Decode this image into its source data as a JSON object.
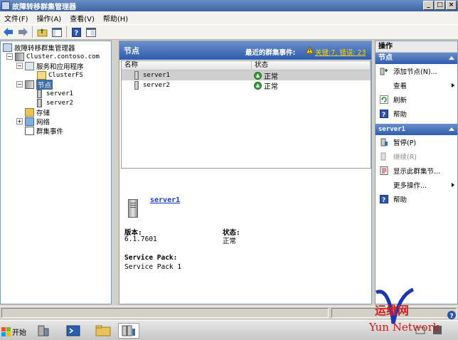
{
  "window": {
    "title": "故障转移群集管理器",
    "controls": [
      "_",
      "□",
      "×"
    ]
  },
  "menu": [
    "文件(F)",
    "操作(A)",
    "查看(V)",
    "帮助(H)"
  ],
  "toolbar": {
    "icons": [
      "back-icon",
      "forward-icon",
      "up-folder-icon",
      "show-hide-console-tree-icon",
      "help-icon",
      "properties-icon"
    ]
  },
  "tree": {
    "root": "故障转移群集管理器",
    "cluster": "Cluster.contoso.com",
    "services": "服务和应用程序",
    "clusterfs": "ClusterFS",
    "nodes": "节点",
    "server1": "server1",
    "server2": "server2",
    "storage": "存储",
    "network": "网络",
    "events": "群集事件"
  },
  "center": {
    "title": "节点",
    "recent_events_label": "最近的群集事件:",
    "recent_events_link": "关键:7, 错误: 23",
    "columns": [
      "名称",
      "状态"
    ],
    "rows": [
      {
        "name": "server1",
        "status": "正常",
        "selected": true
      },
      {
        "name": "server2",
        "status": "正常",
        "selected": false
      }
    ],
    "details": {
      "name": "server1",
      "version_label": "版本:",
      "version_value": "6.1.7601",
      "status_label": "状态:",
      "status_value": "正常",
      "sp_label": "Service Pack:",
      "sp_value": "Service Pack 1"
    }
  },
  "actions": {
    "title": "操作",
    "section1": "节点",
    "items1": [
      {
        "label": "添加节点(N)...",
        "icon": "add-node-icon",
        "disabled": false
      },
      {
        "label": "查看",
        "icon": "",
        "disabled": false,
        "submenu": true
      },
      {
        "label": "刷新",
        "icon": "refresh-icon",
        "disabled": false
      },
      {
        "label": "帮助",
        "icon": "help-icon",
        "disabled": false
      }
    ],
    "section2": "server1",
    "items2": [
      {
        "label": "暂停(P)",
        "icon": "pause-icon",
        "disabled": false
      },
      {
        "label": "继续(R)",
        "icon": "resume-icon",
        "disabled": true
      },
      {
        "label": "显示此群集节...",
        "icon": "show-events-icon",
        "disabled": false
      },
      {
        "label": "更多操作...",
        "icon": "",
        "disabled": false,
        "submenu": true
      },
      {
        "label": "帮助",
        "icon": "help-icon",
        "disabled": false
      }
    ]
  },
  "taskbar": {
    "start": "开始"
  },
  "watermark": {
    "line1": "运维网",
    "line2": "Yun Network"
  },
  "colors": {
    "title_blue": "#3e63a4",
    "link_blue": "#1b39c9",
    "ok_green": "#3a9f3a",
    "watermark_red": "#d22020"
  }
}
